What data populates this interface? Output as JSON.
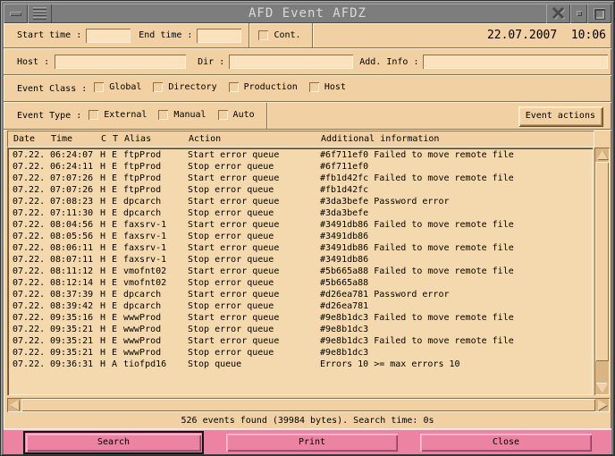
{
  "window": {
    "title": "AFD Event AFDZ"
  },
  "datetime": "22.07.2007  10:06",
  "filters": {
    "start_time_label": "Start time :",
    "start_time_value": "",
    "end_time_label": "End time :",
    "end_time_value": "",
    "cont_label": "Cont.",
    "host_label": "Host :",
    "host_value": "",
    "dir_label": "Dir :",
    "dir_value": "",
    "addinfo_label": "Add. Info :",
    "addinfo_value": ""
  },
  "event_class": {
    "label": "Event Class :",
    "options": [
      {
        "label": "Global",
        "checked": false
      },
      {
        "label": "Directory",
        "checked": false
      },
      {
        "label": "Production",
        "checked": false
      },
      {
        "label": "Host",
        "checked": false
      }
    ]
  },
  "event_type": {
    "label": "Event Type :",
    "options": [
      {
        "label": "External",
        "checked": false
      },
      {
        "label": "Manual",
        "checked": false
      },
      {
        "label": "Auto",
        "checked": false
      }
    ],
    "actions_button": "Event actions"
  },
  "table": {
    "header": {
      "date": "Date",
      "time": "Time",
      "c": "C",
      "t": "T",
      "alias": "Alias",
      "action": "Action",
      "info": "Additional information"
    },
    "rows": [
      {
        "date": "07.22.",
        "time": "06:24:07",
        "c": "H",
        "t": "E",
        "alias": "ftpProd",
        "action": "Start error queue",
        "info": "#6f711ef0 Failed to move remote file"
      },
      {
        "date": "07.22.",
        "time": "06:24:11",
        "c": "H",
        "t": "E",
        "alias": "ftpProd",
        "action": "Stop error queue",
        "info": "#6f711ef0"
      },
      {
        "date": "07.22.",
        "time": "07:07:26",
        "c": "H",
        "t": "E",
        "alias": "ftpProd",
        "action": "Start error queue",
        "info": "#fb1d42fc Failed to move remote file"
      },
      {
        "date": "07.22.",
        "time": "07:07:26",
        "c": "H",
        "t": "E",
        "alias": "ftpProd",
        "action": "Stop error queue",
        "info": "#fb1d42fc"
      },
      {
        "date": "07.22.",
        "time": "07:08:23",
        "c": "H",
        "t": "E",
        "alias": "dpcarch",
        "action": "Start error queue",
        "info": "#3da3befe Password error"
      },
      {
        "date": "07.22.",
        "time": "07:11:30",
        "c": "H",
        "t": "E",
        "alias": "dpcarch",
        "action": "Stop error queue",
        "info": "#3da3befe"
      },
      {
        "date": "07.22.",
        "time": "08:04:56",
        "c": "H",
        "t": "E",
        "alias": "faxsrv-1",
        "action": "Start error queue",
        "info": "#3491db86 Failed to move remote file"
      },
      {
        "date": "07.22.",
        "time": "08:05:56",
        "c": "H",
        "t": "E",
        "alias": "faxsrv-1",
        "action": "Stop error queue",
        "info": "#3491db86"
      },
      {
        "date": "07.22.",
        "time": "08:06:11",
        "c": "H",
        "t": "E",
        "alias": "faxsrv-1",
        "action": "Start error queue",
        "info": "#3491db86 Failed to move remote file"
      },
      {
        "date": "07.22.",
        "time": "08:07:11",
        "c": "H",
        "t": "E",
        "alias": "faxsrv-1",
        "action": "Stop error queue",
        "info": "#3491db86"
      },
      {
        "date": "07.22.",
        "time": "08:11:12",
        "c": "H",
        "t": "E",
        "alias": "vmofnt02",
        "action": "Start error queue",
        "info": "#5b665a88 Failed to move remote file"
      },
      {
        "date": "07.22.",
        "time": "08:12:14",
        "c": "H",
        "t": "E",
        "alias": "vmofnt02",
        "action": "Stop error queue",
        "info": "#5b665a88"
      },
      {
        "date": "07.22.",
        "time": "08:37:39",
        "c": "H",
        "t": "E",
        "alias": "dpcarch",
        "action": "Start error queue",
        "info": "#d26ea781 Password error"
      },
      {
        "date": "07.22.",
        "time": "08:39:42",
        "c": "H",
        "t": "E",
        "alias": "dpcarch",
        "action": "Stop error queue",
        "info": "#d26ea781"
      },
      {
        "date": "07.22.",
        "time": "09:35:16",
        "c": "H",
        "t": "E",
        "alias": "wwwProd",
        "action": "Start error queue",
        "info": "#9e8b1dc3 Failed to move remote file"
      },
      {
        "date": "07.22.",
        "time": "09:35:21",
        "c": "H",
        "t": "E",
        "alias": "wwwProd",
        "action": "Stop error queue",
        "info": "#9e8b1dc3"
      },
      {
        "date": "07.22.",
        "time": "09:35:21",
        "c": "H",
        "t": "E",
        "alias": "wwwProd",
        "action": "Start error queue",
        "info": "#9e8b1dc3 Failed to move remote file"
      },
      {
        "date": "07.22.",
        "time": "09:35:21",
        "c": "H",
        "t": "E",
        "alias": "wwwProd",
        "action": "Stop error queue",
        "info": "#9e8b1dc3"
      },
      {
        "date": "07.22.",
        "time": "09:36:31",
        "c": "H",
        "t": "A",
        "alias": "tiofpd16",
        "action": "Stop queue",
        "info": "Errors 10 >= max errors 10"
      }
    ]
  },
  "status_text": "526 events found (39984 bytes). Search time: 0s",
  "footer": {
    "buttons": {
      "search": "Search",
      "print": "Print",
      "close": "Close"
    }
  },
  "colors": {
    "panel_background": "#f1d1a4",
    "list_background": "#f5d9ae",
    "field_background": "#f9e2bd",
    "titlebar_gray": "#7d7d7d",
    "footer_pink": "#ec83a3",
    "bevel_light": "#fff1d7",
    "bevel_dark": "#8e6f45"
  }
}
